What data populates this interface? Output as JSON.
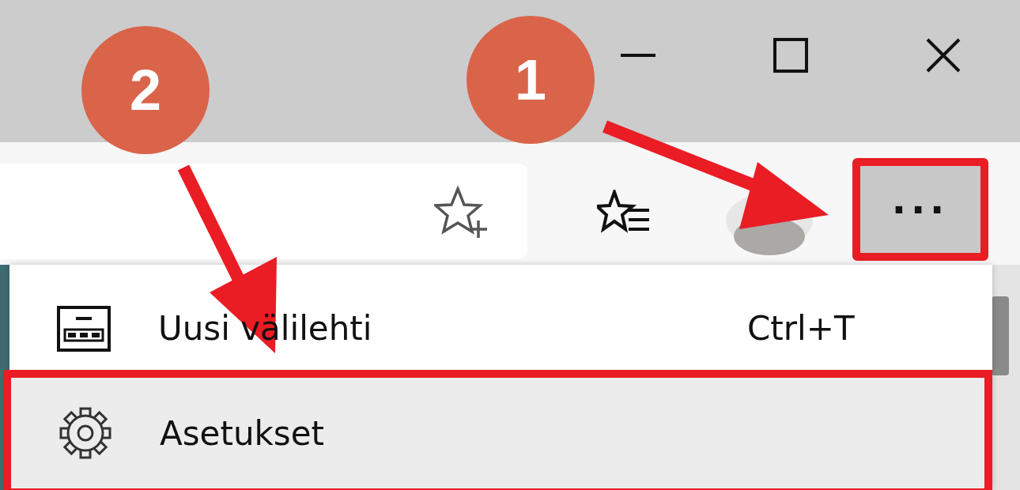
{
  "window_controls": [
    {
      "kind": "minimize"
    },
    {
      "kind": "maximize"
    },
    {
      "kind": "close"
    }
  ],
  "toolbar": {
    "favorites_button": {
      "kind": "favorites"
    },
    "menu_button": {
      "label": "···",
      "highlighted": true
    }
  },
  "menu": {
    "items": [
      {
        "kind": "new-tab",
        "label": "Uusi välilehti",
        "shortcut": "Ctrl+T",
        "selected": false,
        "highlighted": false
      },
      {
        "kind": "settings",
        "label": "Asetukset",
        "selected": true,
        "highlighted": true
      }
    ]
  },
  "annotations": [
    {
      "label": "2"
    },
    {
      "label": "1"
    }
  ]
}
